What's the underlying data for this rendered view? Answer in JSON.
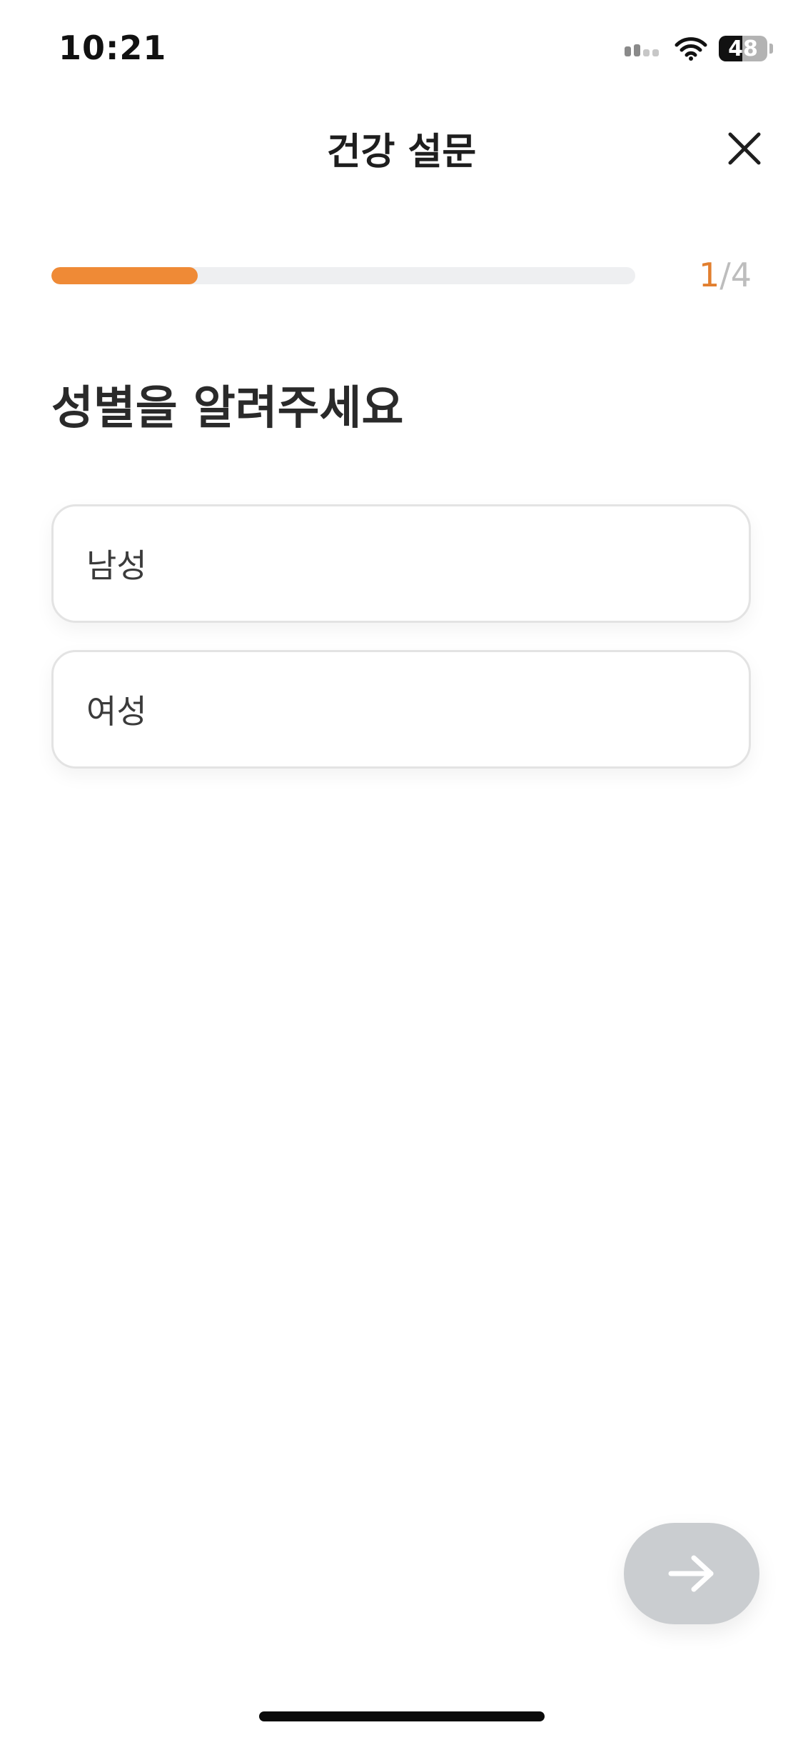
{
  "status_bar": {
    "time": "10:21",
    "battery_level": "48",
    "icons": [
      "cellular-signal-icon",
      "wifi-icon",
      "battery-icon"
    ]
  },
  "header": {
    "title": "건강 설문",
    "close_icon": "close-icon"
  },
  "progress": {
    "current": "1",
    "separator": "/",
    "total": "4",
    "fraction": 0.25,
    "fill_color": "#ef8a36",
    "track_color": "#eeeff1"
  },
  "question": {
    "title": "성별을 알려주세요"
  },
  "options": [
    {
      "label": "남성"
    },
    {
      "label": "여성"
    }
  ],
  "next_button": {
    "icon": "arrow-right-icon",
    "color": "#cacdd0"
  }
}
